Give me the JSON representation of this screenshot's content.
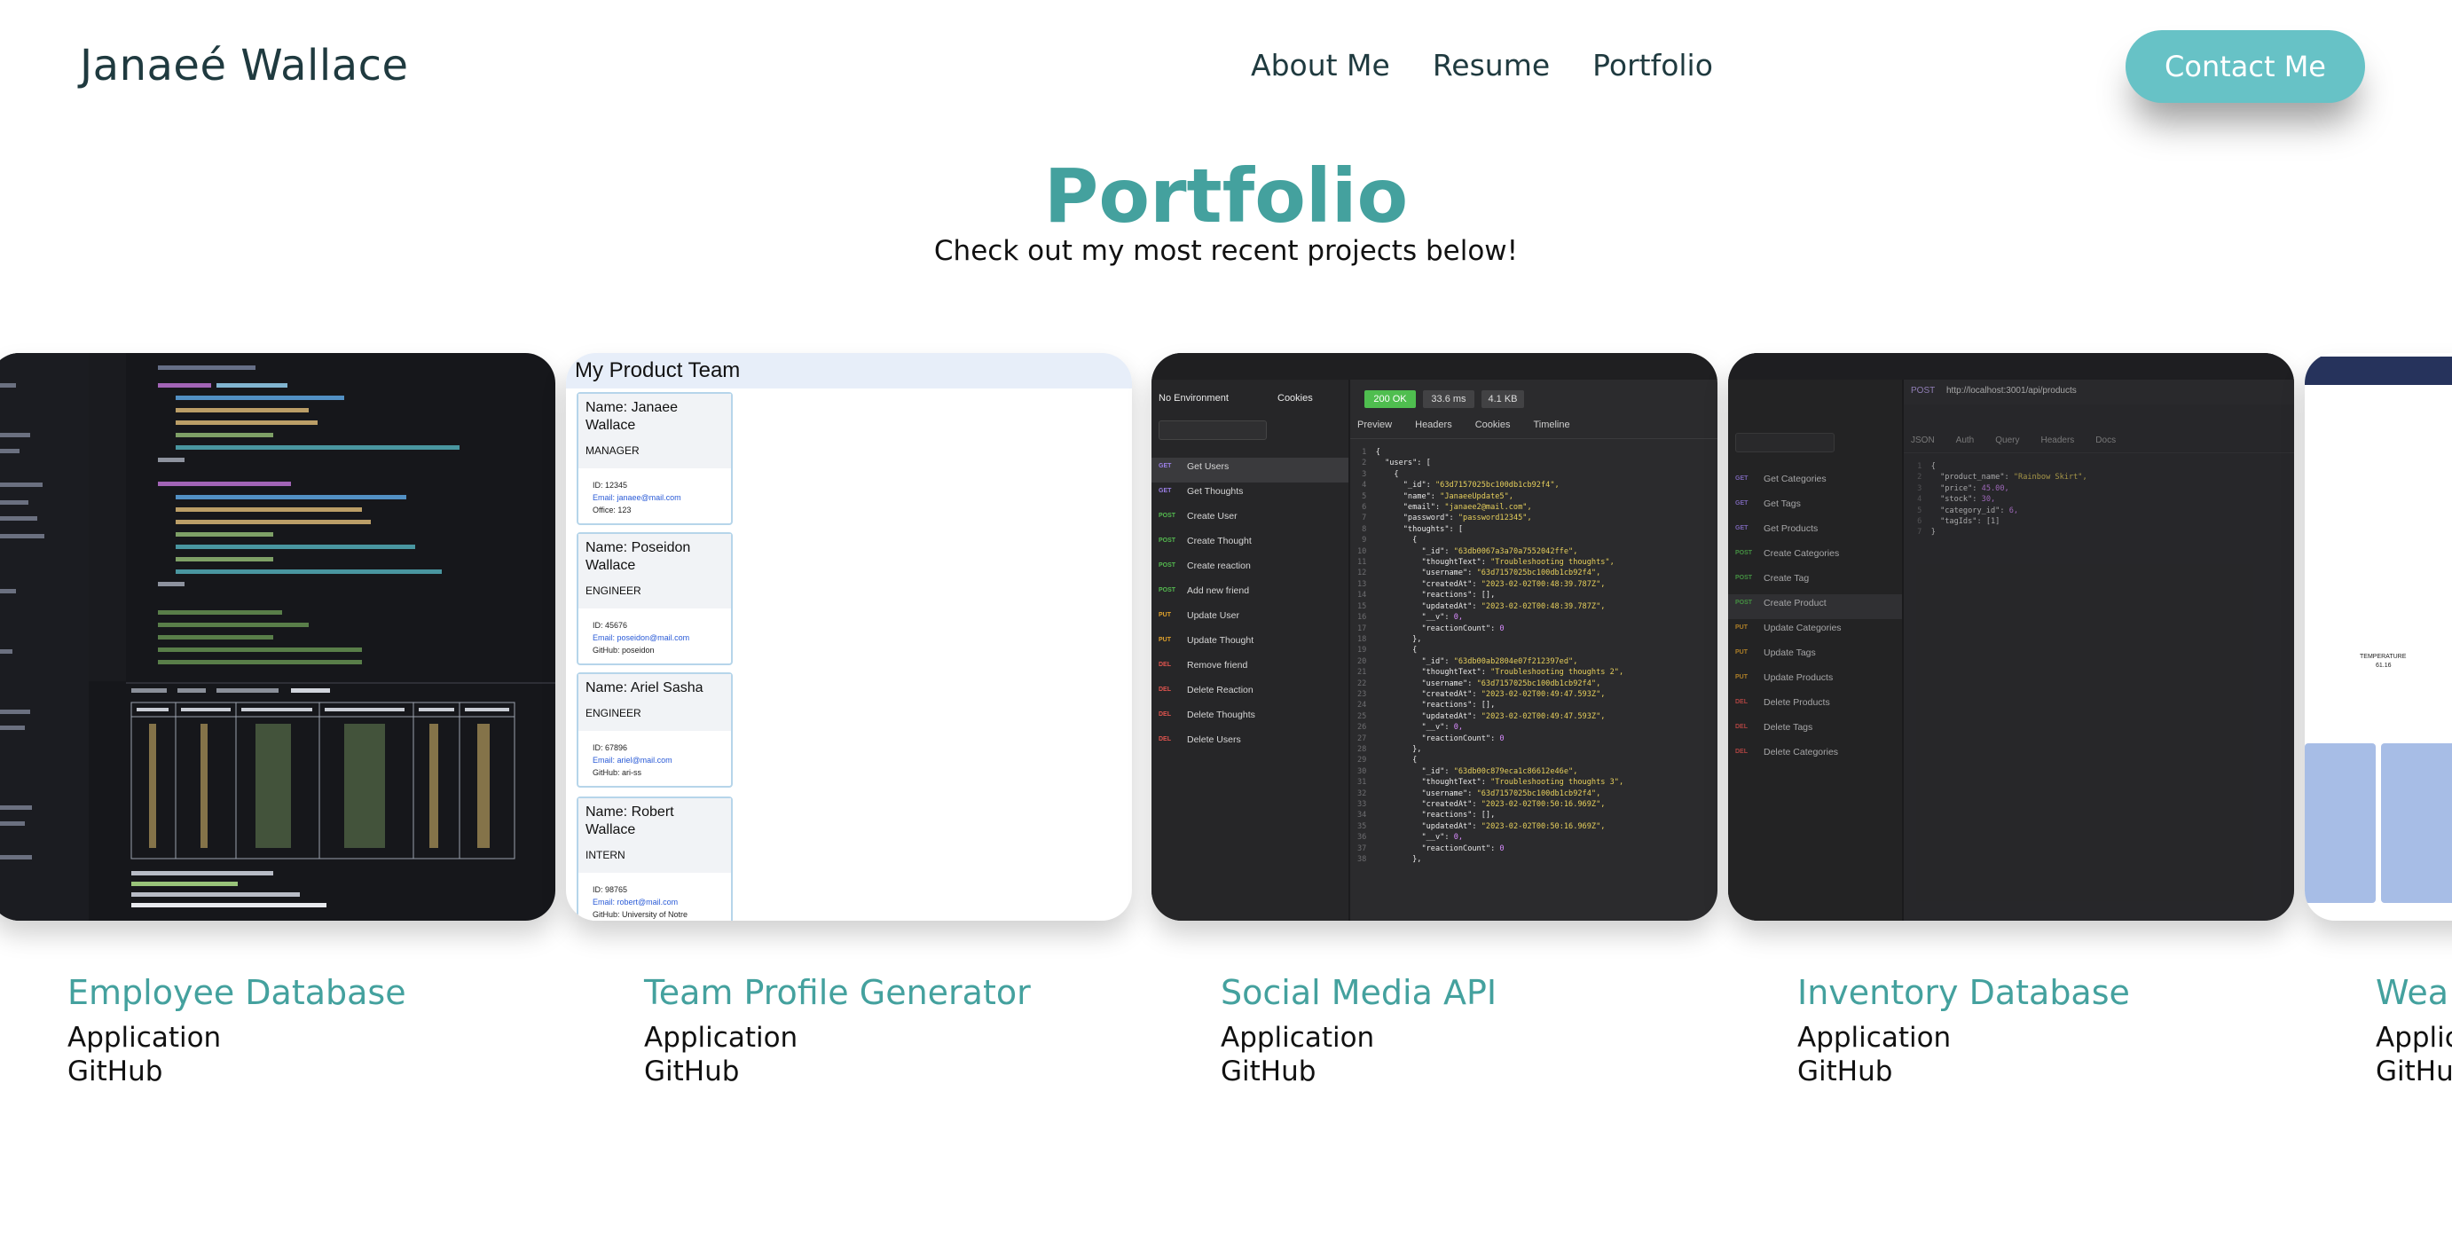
{
  "header": {
    "brand": "Janaeé Wallace",
    "nav": [
      "About Me",
      "Resume",
      "Portfolio"
    ],
    "contact_button": "Contact Me"
  },
  "hero": {
    "title": "Portfolio",
    "subtitle": "Check out my most recent projects below!"
  },
  "projects": [
    {
      "title": "Employee Database",
      "app_label": "Application",
      "github_label": "GitHub"
    },
    {
      "title": "Team Profile Generator",
      "app_label": "Application",
      "github_label": "GitHub"
    },
    {
      "title": "Social Media API",
      "app_label": "Application",
      "github_label": "GitHub"
    },
    {
      "title": "Inventory Database",
      "app_label": "Application",
      "github_label": "GitHub"
    },
    {
      "title": "Wea",
      "app_label": "Applic",
      "github_label": "GitHu"
    }
  ],
  "screens": {
    "team": {
      "heading": "My Product Team",
      "members": [
        {
          "name_1": "Name: Janaee",
          "name_2": "Wallace",
          "role": "MANAGER",
          "id": "ID: 12345",
          "email": "Email: janaee@mail.com",
          "extra": "Office: 123"
        },
        {
          "name_1": "Name: Poseidon",
          "name_2": "Wallace",
          "role": "ENGINEER",
          "id": "ID: 45676",
          "email": "Email: poseidon@mail.com",
          "extra": "GitHub: poseidon"
        },
        {
          "name_1": "Name: Ariel Sasha",
          "name_2": "",
          "role": "ENGINEER",
          "id": "ID: 67896",
          "email": "Email: ariel@mail.com",
          "extra": "GitHub: ari-ss"
        },
        {
          "name_1": "Name: Robert",
          "name_2": "Wallace",
          "role": "INTERN",
          "id": "ID: 98765",
          "email": "Email: robert@mail.com",
          "extra": "GitHub: University of Notre"
        }
      ]
    },
    "social": {
      "env": "No Environment",
      "cookies": "Cookies",
      "status": "200 OK",
      "time": "33.6 ms",
      "size": "4.1 KB",
      "tabs": [
        "Preview",
        "Headers",
        "Cookies",
        "Timeline"
      ],
      "requests": [
        {
          "method": "GET",
          "name": "Get Users"
        },
        {
          "method": "GET",
          "name": "Get Thoughts"
        },
        {
          "method": "POST",
          "name": "Create User"
        },
        {
          "method": "POST",
          "name": "Create Thought"
        },
        {
          "method": "POST",
          "name": "Create reaction"
        },
        {
          "method": "POST",
          "name": "Add new friend"
        },
        {
          "method": "PUT",
          "name": "Update User"
        },
        {
          "method": "PUT",
          "name": "Update Thought"
        },
        {
          "method": "DEL",
          "name": "Remove friend"
        },
        {
          "method": "DEL",
          "name": "Delete Reaction"
        },
        {
          "method": "DEL",
          "name": "Delete Thoughts"
        },
        {
          "method": "DEL",
          "name": "Delete Users"
        }
      ],
      "json_lines": [
        "{",
        "\"users\": [",
        "{",
        "\"_id\": \"63d7157025bc100db1cb92f4\",",
        "\"name\": \"JanaeeUpdate5\",",
        "\"email\": \"janaee2@mail.com\",",
        "\"password\": \"password12345\",",
        "\"thoughts\": [",
        "{",
        "\"_id\": \"63db0067a3a70a7552042ffe\",",
        "\"thoughtText\": \"Troubleshooting thoughts\",",
        "\"username\": \"63d7157025bc100db1cb92f4\",",
        "\"createdAt\": \"2023-02-02T00:48:39.787Z\",",
        "\"reactions\": [],",
        "\"updatedAt\": \"2023-02-02T00:48:39.787Z\",",
        "\"__v\": 0,",
        "\"reactionCount\": 0",
        "},",
        "{",
        "\"_id\": \"63db00ab2804e07f212397ed\",",
        "\"thoughtText\": \"Troubleshooting thoughts 2\",",
        "\"username\": \"63d7157025bc100db1cb92f4\",",
        "\"createdAt\": \"2023-02-02T00:49:47.593Z\",",
        "\"reactions\": [],",
        "\"updatedAt\": \"2023-02-02T00:49:47.593Z\",",
        "\"__v\": 0,",
        "\"reactionCount\": 0",
        "},",
        "{",
        "\"_id\": \"63db00c879eca1c86612e46e\",",
        "\"thoughtText\": \"Troubleshooting thoughts 3\",",
        "\"username\": \"63d7157025bc100db1cb92f4\",",
        "\"createdAt\": \"2023-02-02T00:50:16.969Z\",",
        "\"reactions\": [],",
        "\"updatedAt\": \"2023-02-02T00:50:16.969Z\",",
        "\"__v\": 0,",
        "\"reactionCount\": 0",
        "},"
      ]
    },
    "inventory": {
      "url": "http://localhost:3001/api/products",
      "method": "POST",
      "tabs": [
        "JSON",
        "Auth",
        "Query",
        "Headers",
        "Docs"
      ],
      "requests": [
        {
          "method": "GET",
          "name": "Get Categories"
        },
        {
          "method": "GET",
          "name": "Get Tags"
        },
        {
          "method": "GET",
          "name": "Get Products"
        },
        {
          "method": "POST",
          "name": "Create Categories"
        },
        {
          "method": "POST",
          "name": "Create Tag"
        },
        {
          "method": "POST",
          "name": "Create Product"
        },
        {
          "method": "PUT",
          "name": "Update Categories"
        },
        {
          "method": "PUT",
          "name": "Update Tags"
        },
        {
          "method": "PUT",
          "name": "Update Products"
        },
        {
          "method": "DEL",
          "name": "Delete Products"
        },
        {
          "method": "DEL",
          "name": "Delete Tags"
        },
        {
          "method": "DEL",
          "name": "Delete Categories"
        }
      ],
      "body_lines": [
        "{",
        "\"product_name\": \"Rainbow Skirt\",",
        "\"price\": 45.00,",
        "\"stock\": 30,",
        "\"category_id\": 6,",
        "\"tagIds\": [1]",
        "}"
      ]
    },
    "weather": {
      "label": "TEMPERATURE",
      "value": "61.16"
    }
  }
}
